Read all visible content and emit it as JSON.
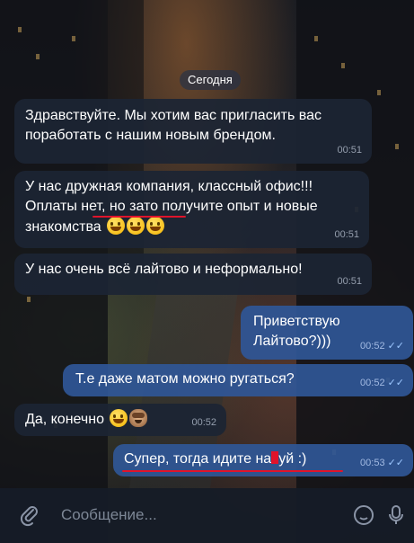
{
  "date_label": "Сегодня",
  "messages": [
    {
      "text": "Здравствуйте. Мы хотим вас пригласить вас поработать с нашим новым брендом.",
      "time": "00:51"
    },
    {
      "text_before": "У нас дружная компания, классный офис!!! ",
      "text_underlined": "Оплаты нет",
      "text_after": ", но зато получите опыт и новые знакомства",
      "time": "00:51"
    },
    {
      "text": "У нас очень всё лайтово и неформально!",
      "time": "00:51"
    },
    {
      "text": "Приветствую Лайтово?)))",
      "time": "00:52"
    },
    {
      "text": "Т.е даже матом можно ругаться?",
      "time": "00:52"
    },
    {
      "text": "Да, конечно",
      "time": "00:52"
    },
    {
      "text_before": "Супер, тогда идите на",
      "text_after": "уй :)",
      "time": "00:53"
    }
  ],
  "input": {
    "placeholder": "Сообщение..."
  },
  "icons": {
    "attach": "paperclip-icon",
    "sticker": "sticker-icon",
    "mic": "microphone-icon"
  },
  "colors": {
    "incoming": "#1c2534",
    "outgoing": "#2f5696",
    "highlight": "#e0142b"
  }
}
